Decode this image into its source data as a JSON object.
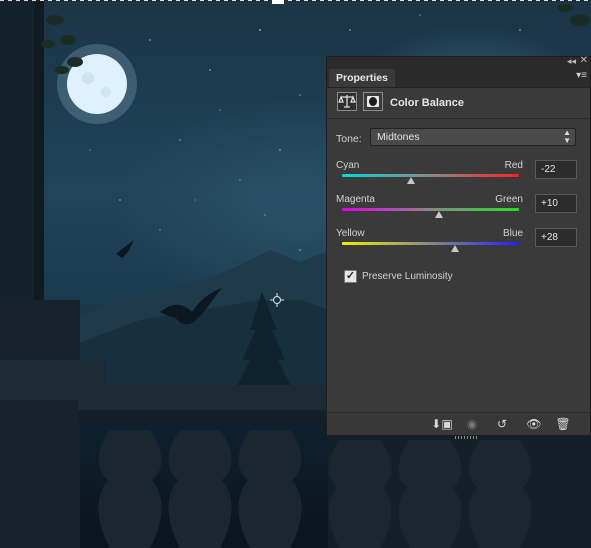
{
  "panel": {
    "tab_label": "Properties",
    "collapse_icon": "double-chevron-right-icon",
    "close_icon": "close-icon",
    "menu_icon": "panel-menu-icon",
    "title": "Color Balance",
    "tone": {
      "label": "Tone:",
      "selected": "Midtones"
    },
    "sliders": [
      {
        "left": "Cyan",
        "right": "Red",
        "value": "-22",
        "level": -22,
        "track_colors": [
          "#00d8d8",
          "#ff2020"
        ]
      },
      {
        "left": "Magenta",
        "right": "Green",
        "value": "+10",
        "level": 10,
        "track_colors": [
          "#e000e0",
          "#20e020"
        ]
      },
      {
        "left": "Yellow",
        "right": "Blue",
        "value": "+28",
        "level": 28,
        "track_colors": [
          "#f0f000",
          "#2020ff"
        ]
      }
    ],
    "preserve_luminosity": {
      "label": "Preserve Luminosity",
      "checked": true
    },
    "toolbar": [
      "clip-to-layer-icon",
      "view-previous-state-icon",
      "reset-icon",
      "toggle-visibility-icon",
      "delete-icon"
    ]
  },
  "colors": {
    "panel_bg": "#3a3a3a",
    "panel_dark": "#2b2b2b",
    "text": "#d6d6d6",
    "moon": "#dff0ff"
  }
}
